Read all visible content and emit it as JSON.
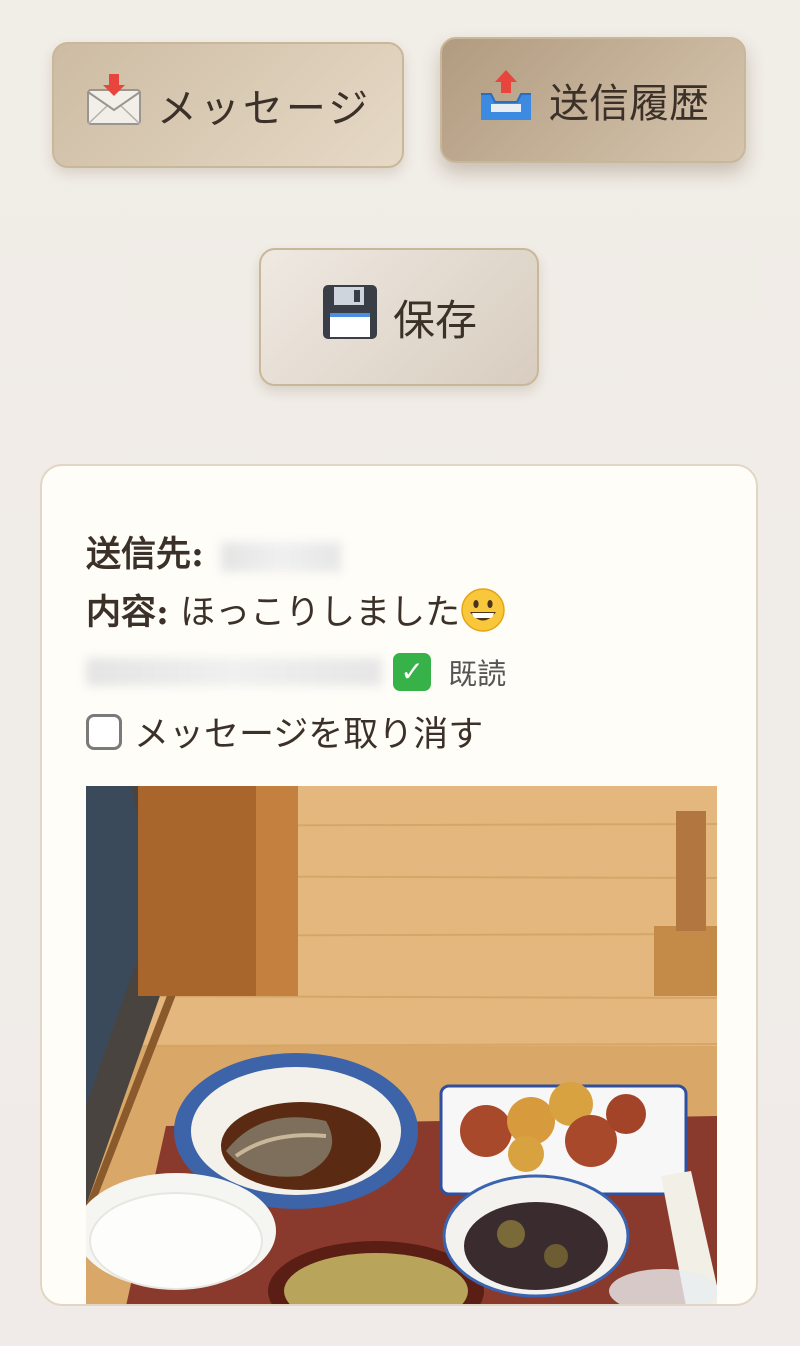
{
  "toolbar": {
    "message_label": "メッセージ",
    "message_icon": "envelope-incoming-icon",
    "history_label": "送信履歴",
    "history_icon": "outbox-tray-icon",
    "save_label": "保存",
    "save_icon": "floppy-disk-icon"
  },
  "message_card": {
    "recipient_label": "送信先:",
    "content_label": "内容:",
    "content_text": "ほっこりしました",
    "content_emoji": "grinning-face-icon",
    "read_status": "既読",
    "read_icon": "check-mark-button-icon",
    "retract_label": "メッセージを取り消す"
  },
  "colors": {
    "background": "#f1ede7",
    "card_background": "#fffdf8",
    "button_accent": "#cdbca3",
    "read_badge": "#36b249"
  }
}
